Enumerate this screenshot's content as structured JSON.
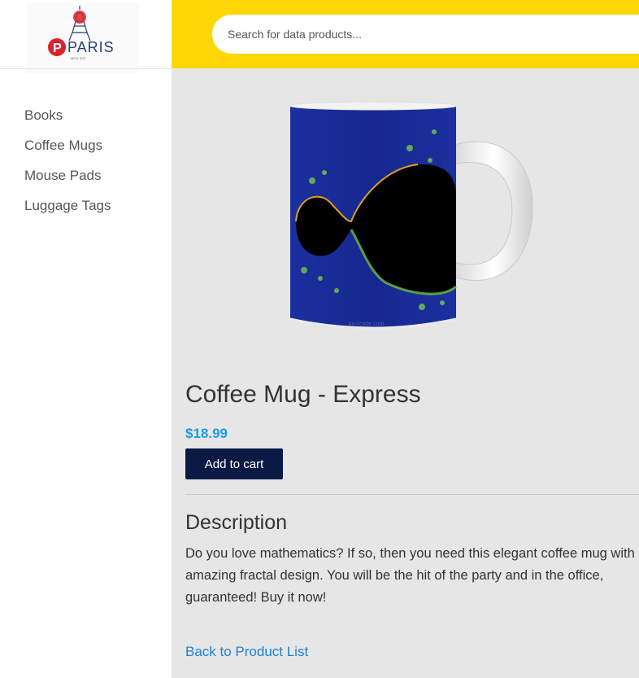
{
  "logo": {
    "text": "PARIS",
    "tagline": "MEM.SUP"
  },
  "search": {
    "placeholder": "Search for data products..."
  },
  "sidebar": {
    "items": [
      {
        "label": "Books"
      },
      {
        "label": "Coffee Mugs"
      },
      {
        "label": "Mouse Pads"
      },
      {
        "label": "Luggage Tags"
      }
    ]
  },
  "product": {
    "name": "Coffee Mug - Express",
    "price": "$18.99",
    "add_to_cart": "Add to cart",
    "image_watermark": "luv2code.com",
    "description_heading": "Description",
    "description": "Do you love mathematics? If so, then you need this elegant coffee mug with an amazing fractal design. You will be the hit of the party and in the office, guaranteed! Buy it now!",
    "back_link": "Back to Product List"
  },
  "colors": {
    "header": "#ffd707",
    "button": "#0b1a45",
    "price": "#1a9ee0",
    "link": "#1e7fd6"
  }
}
